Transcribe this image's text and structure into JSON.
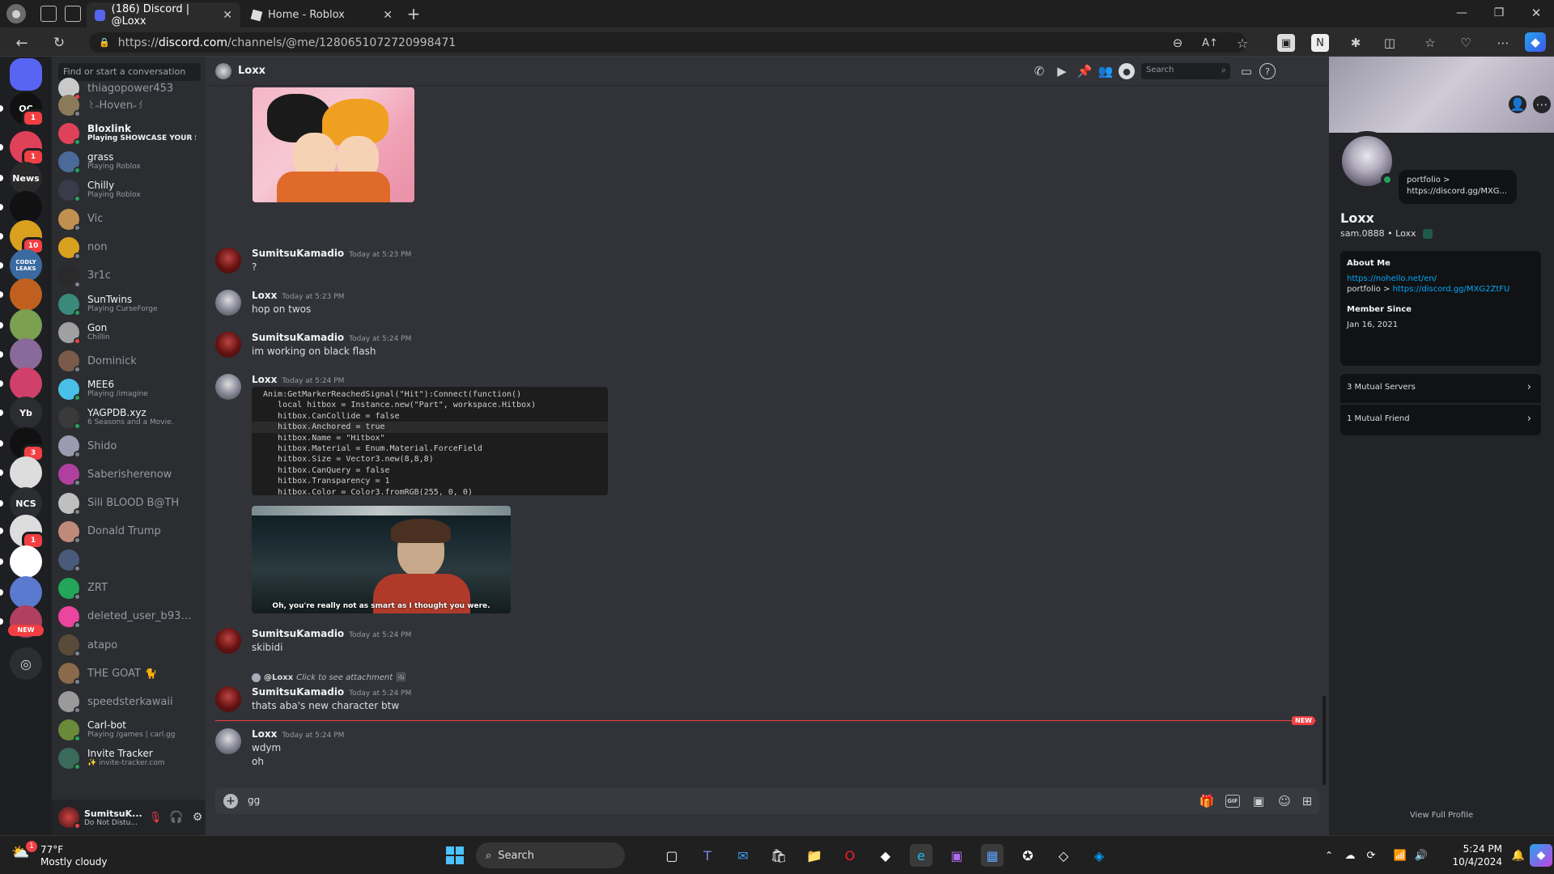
{
  "browser": {
    "tabs": [
      {
        "title": "(186) Discord | @Loxx",
        "active": true
      },
      {
        "title": "Home - Roblox",
        "active": false
      }
    ],
    "url_prefix": "https://",
    "url_host": "discord.com",
    "url_path": "/channels/@me/1280651072720998471"
  },
  "servers": {
    "items": [
      {
        "label": "",
        "badge": ""
      },
      {
        "label": "QC",
        "badge": "1"
      },
      {
        "label": "",
        "badge": "1"
      },
      {
        "label": "News",
        "badge": ""
      },
      {
        "label": "",
        "badge": ""
      },
      {
        "label": "",
        "badge": "10"
      },
      {
        "label": "CODLY LEAKS",
        "badge": ""
      },
      {
        "label": "",
        "badge": ""
      },
      {
        "label": "",
        "badge": ""
      },
      {
        "label": "",
        "badge": ""
      },
      {
        "label": "",
        "badge": ""
      },
      {
        "label": "Yb",
        "badge": ""
      },
      {
        "label": "",
        "badge": "3"
      },
      {
        "label": "",
        "badge": ""
      },
      {
        "label": "NCS",
        "badge": ""
      },
      {
        "label": "",
        "badge": "1"
      },
      {
        "label": "",
        "badge": ""
      },
      {
        "label": "",
        "badge": ""
      },
      {
        "label": "",
        "badge": ""
      }
    ],
    "new_badge": "NEW"
  },
  "dm_list": {
    "search_placeholder": "Find or start a conversation",
    "items": [
      {
        "name": "thiagopower453",
        "sub": "",
        "status": "#f23f43",
        "color": "#c9c9c9"
      },
      {
        "name": "꒰˶Hoven˶꒱",
        "sub": "",
        "status": "#80848e",
        "color": "#8a7a5a"
      },
      {
        "name": "Bloxlink",
        "sub": "Playing SHOWCASE YOUR SE...",
        "status": "#23a55a",
        "color": "#e0415a"
      },
      {
        "name": "grass",
        "sub": "Playing Roblox",
        "status": "#23a55a",
        "color": "#4a6a9a"
      },
      {
        "name": "Chilly",
        "sub": "Playing Roblox",
        "status": "#23a55a",
        "color": "#3a3a4a"
      },
      {
        "name": "Vic",
        "sub": "",
        "status": "#80848e",
        "color": "#c09050"
      },
      {
        "name": "non",
        "sub": "",
        "status": "#80848e",
        "color": "#d9a020"
      },
      {
        "name": "3r1c",
        "sub": "",
        "status": "#80848e",
        "color": "#2a2a2a"
      },
      {
        "name": "SunTwins",
        "sub": "Playing CurseForge",
        "status": "#23a55a",
        "color": "#3a8a7a"
      },
      {
        "name": "Gon",
        "sub": "Chillin",
        "status": "#f23f43",
        "color": "#a0a0a0"
      },
      {
        "name": "Dominick",
        "sub": "",
        "status": "#80848e",
        "color": "#7a5a4a"
      },
      {
        "name": "MEE6",
        "sub": "Playing /imagine",
        "status": "#23a55a",
        "color": "#4ac0e8"
      },
      {
        "name": "YAGPDB.xyz",
        "sub": "6 Seasons and a Movie.",
        "status": "#23a55a",
        "color": "#3a3a3a"
      },
      {
        "name": "Shido",
        "sub": "",
        "status": "#80848e",
        "color": "#9a9ab0"
      },
      {
        "name": "Saberisherenow",
        "sub": "",
        "status": "#80848e",
        "color": "#b040a0"
      },
      {
        "name": "Sili BLOOD B@TH",
        "sub": "",
        "status": "#80848e",
        "color": "#bfbfbf"
      },
      {
        "name": "Donald Trump",
        "sub": "",
        "status": "#80848e",
        "color": "#c08a7a"
      },
      {
        "name": "",
        "sub": "",
        "status": "#80848e",
        "color": "#4a5a7a"
      },
      {
        "name": "ZRT",
        "sub": "",
        "status": "#80848e",
        "color": "#23a55a"
      },
      {
        "name": "deleted_user_b93c97...",
        "sub": "",
        "status": "#80848e",
        "color": "#eb459e"
      },
      {
        "name": "atapo",
        "sub": "",
        "status": "#80848e",
        "color": "#5a4a3a"
      },
      {
        "name": "THE GOAT 🐈",
        "sub": "",
        "status": "#80848e",
        "color": "#8a6a4a"
      },
      {
        "name": "speedsterkawaii",
        "sub": "",
        "status": "#80848e",
        "color": "#9a9a9a"
      },
      {
        "name": "Carl-bot",
        "sub": "Playing /games | carl.gg",
        "status": "#23a55a",
        "color": "#6a8a3a"
      },
      {
        "name": "Invite Tracker",
        "sub": "✨ invite-tracker.com",
        "status": "#23a55a",
        "color": "#3a6a5a"
      }
    ]
  },
  "user_panel": {
    "name": "SumitsuK...",
    "status": "Do Not Distu..."
  },
  "chat": {
    "header_name": "Loxx",
    "search_placeholder": "Search",
    "messages": [
      {
        "author": "SumitsuKamadio",
        "time": "Today at 5:23 PM",
        "text": "?"
      },
      {
        "author": "Loxx",
        "time": "Today at 5:23 PM",
        "text": "hop on twos"
      },
      {
        "author": "SumitsuKamadio",
        "time": "Today at 5:24 PM",
        "text": "im working on black flash"
      },
      {
        "author": "Loxx",
        "time": "Today at 5:24 PM",
        "text": ""
      },
      {
        "author": "SumitsuKamadio",
        "time": "Today at 5:24 PM",
        "text": "skibidi"
      },
      {
        "author": "SumitsuKamadio",
        "time": "Today at 5:24 PM",
        "text": "thats aba's new character btw"
      },
      {
        "author": "Loxx",
        "time": "Today at 5:24 PM",
        "text": "wdym"
      }
    ],
    "extra_line": "oh",
    "reply_author": "@Loxx",
    "reply_text": "Click to see attachment",
    "video_caption": "Oh, you're really not as smart as I thought you were.",
    "new_label": "NEW",
    "composer_value": "gg",
    "code_lines": [
      "Anim:GetMarkerReachedSignal(\"Hit\"):Connect(function()",
      "   local hitbox = Instance.new(\"Part\", workspace.Hitbox)",
      "   hitbox.CanCollide = false",
      "   hitbox.Anchored = true",
      "   hitbox.Name = \"Hitbox\"",
      "   hitbox.Material = Enum.Material.ForceField",
      "   hitbox.Size = Vector3.new(8,8,8)",
      "   hitbox.CanQuery = false",
      "   hitbox.Transparency = 1",
      "   hitbox.Color = Color3.fromRGB(255, 0, 0)"
    ]
  },
  "profile": {
    "status_note": "portfolio > https://discord.gg/MXG...",
    "display_name": "Loxx",
    "username_line": "sam.0888 • Loxx",
    "about_title": "About Me",
    "about_link1": "https://nohello.net/en/",
    "about_prefix": "portfolio > ",
    "about_link2": "https://discord.gg/MXG2ZtFU",
    "member_since_title": "Member Since",
    "member_since": "Jan 16, 2021",
    "mutual_servers": "3 Mutual Servers",
    "mutual_friends": "1 Mutual Friend",
    "view_full": "View Full Profile"
  },
  "taskbar": {
    "weather_temp": "77°F",
    "weather_desc": "Mostly cloudy",
    "search_label": "Search",
    "time": "5:24 PM",
    "date": "10/4/2024"
  }
}
